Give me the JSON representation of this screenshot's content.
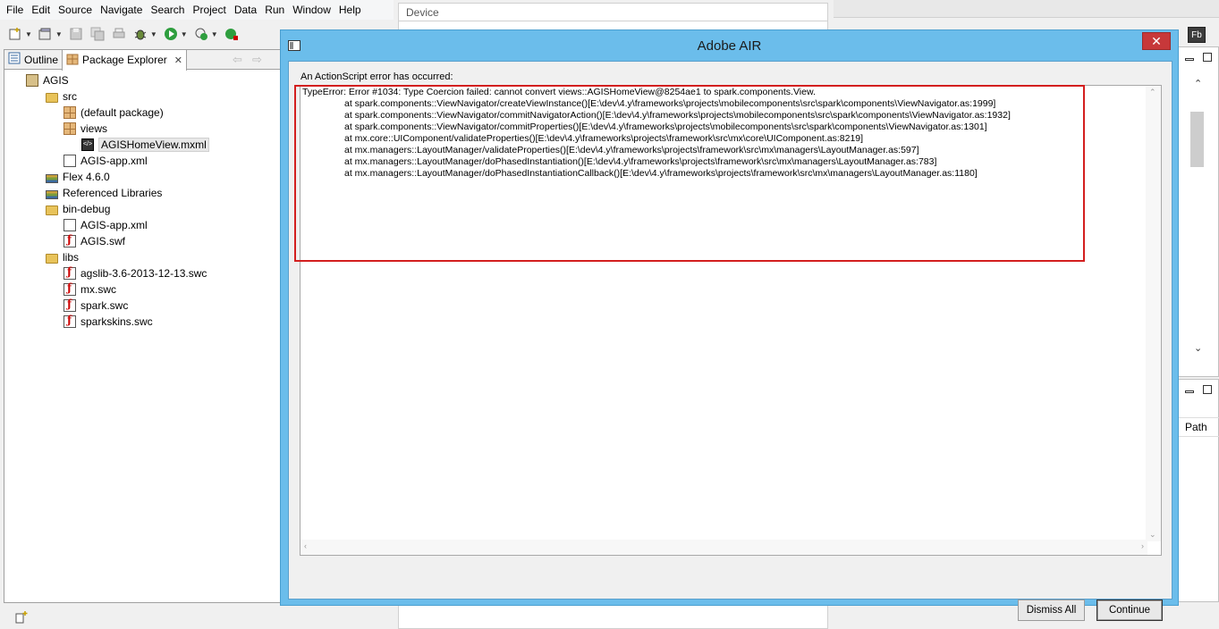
{
  "menu": [
    "File",
    "Edit",
    "Source",
    "Navigate",
    "Search",
    "Project",
    "Data",
    "Run",
    "Window",
    "Help"
  ],
  "left_panel": {
    "tabs": [
      {
        "label": "Outline",
        "icon": "outline-icon"
      },
      {
        "label": "Package Explorer",
        "icon": "package-explorer-icon"
      }
    ],
    "tree": [
      {
        "label": "AGIS",
        "depth": 0,
        "icon": "project"
      },
      {
        "label": "src",
        "depth": 1,
        "icon": "folder"
      },
      {
        "label": "(default package)",
        "depth": 2,
        "icon": "pkg"
      },
      {
        "label": "views",
        "depth": 2,
        "icon": "pkg"
      },
      {
        "label": "AGISHomeView.mxml",
        "depth": 3,
        "icon": "mxml",
        "selected": true
      },
      {
        "label": "AGIS-app.xml",
        "depth": 2,
        "icon": "file"
      },
      {
        "label": "Flex 4.6.0",
        "depth": 1,
        "icon": "lib"
      },
      {
        "label": "Referenced Libraries",
        "depth": 1,
        "icon": "lib"
      },
      {
        "label": "bin-debug",
        "depth": 1,
        "icon": "folder"
      },
      {
        "label": "AGIS-app.xml",
        "depth": 2,
        "icon": "file"
      },
      {
        "label": "AGIS.swf",
        "depth": 2,
        "icon": "swf"
      },
      {
        "label": "libs",
        "depth": 1,
        "icon": "folder"
      },
      {
        "label": "agslib-3.6-2013-12-13.swc",
        "depth": 2,
        "icon": "swf"
      },
      {
        "label": "mx.swc",
        "depth": 2,
        "icon": "swf"
      },
      {
        "label": "spark.swc",
        "depth": 2,
        "icon": "swf"
      },
      {
        "label": "sparkskins.swc",
        "depth": 2,
        "icon": "swf"
      }
    ]
  },
  "device_panel": {
    "title": "Device"
  },
  "right_panel": {
    "column_header": "Path"
  },
  "dialog": {
    "title": "Adobe AIR",
    "close_label": "✕",
    "message": "An ActionScript error has occurred:",
    "trace": [
      "TypeError: Error #1034: Type Coercion failed: cannot convert views::AGISHomeView@8254ae1 to spark.components.View.",
      "at spark.components::ViewNavigator/createViewInstance()[E:\\dev\\4.y\\frameworks\\projects\\mobilecomponents\\src\\spark\\components\\ViewNavigator.as:1999]",
      "at spark.components::ViewNavigator/commitNavigatorAction()[E:\\dev\\4.y\\frameworks\\projects\\mobilecomponents\\src\\spark\\components\\ViewNavigator.as:1932]",
      "at spark.components::ViewNavigator/commitProperties()[E:\\dev\\4.y\\frameworks\\projects\\mobilecomponents\\src\\spark\\components\\ViewNavigator.as:1301]",
      "at mx.core::UIComponent/validateProperties()[E:\\dev\\4.y\\frameworks\\projects\\framework\\src\\mx\\core\\UIComponent.as:8219]",
      "at mx.managers::LayoutManager/validateProperties()[E:\\dev\\4.y\\frameworks\\projects\\framework\\src\\mx\\managers\\LayoutManager.as:597]",
      "at mx.managers::LayoutManager/doPhasedInstantiation()[E:\\dev\\4.y\\frameworks\\projects\\framework\\src\\mx\\managers\\LayoutManager.as:783]",
      "at mx.managers::LayoutManager/doPhasedInstantiationCallback()[E:\\dev\\4.y\\frameworks\\projects\\framework\\src\\mx\\managers\\LayoutManager.as:1180]"
    ],
    "buttons": {
      "dismiss_all": "Dismiss All",
      "continue": "Continue"
    }
  },
  "colors": {
    "dialog_frame": "#6bbdeb",
    "close_button": "#c7383a",
    "highlight": "#d31f1f"
  }
}
